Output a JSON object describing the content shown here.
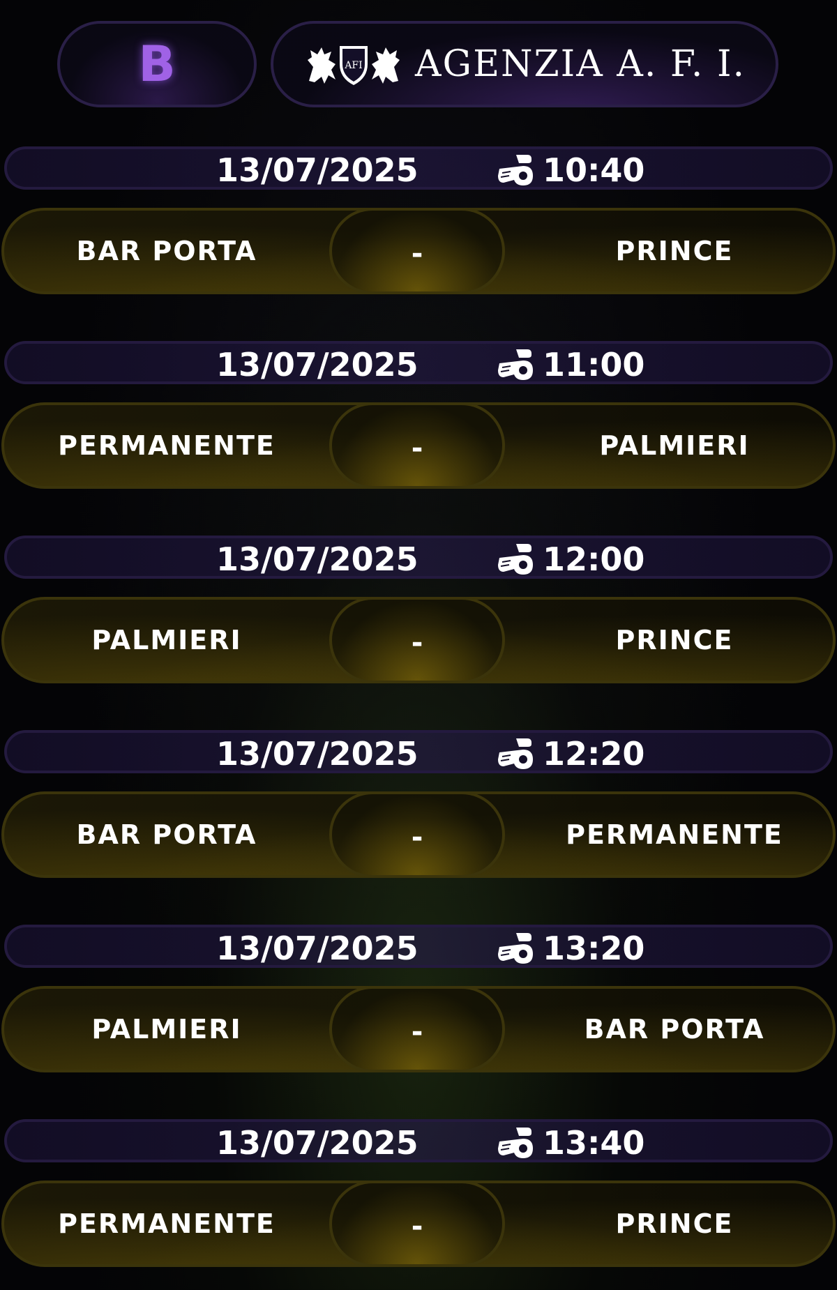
{
  "header": {
    "group_label": "B",
    "brand_name": "AGENZIA A. F. I.",
    "logo_icon": "heraldic-lions-shield-icon",
    "accent_color": "#a062e6"
  },
  "time_icon": "whistle-icon",
  "matches": [
    {
      "date": "13/07/2025",
      "time": "10:40",
      "home": "BAR PORTA",
      "separator": "-",
      "away": "PRINCE"
    },
    {
      "date": "13/07/2025",
      "time": "11:00",
      "home": "PERMANENTE",
      "separator": "-",
      "away": "PALMIERI"
    },
    {
      "date": "13/07/2025",
      "time": "12:00",
      "home": "PALMIERI",
      "separator": "-",
      "away": "PRINCE"
    },
    {
      "date": "13/07/2025",
      "time": "12:20",
      "home": "BAR PORTA",
      "separator": "-",
      "away": "PERMANENTE"
    },
    {
      "date": "13/07/2025",
      "time": "13:20",
      "home": "PALMIERI",
      "separator": "-",
      "away": "BAR PORTA"
    },
    {
      "date": "13/07/2025",
      "time": "13:40",
      "home": "PERMANENTE",
      "separator": "-",
      "away": "PRINCE"
    }
  ]
}
